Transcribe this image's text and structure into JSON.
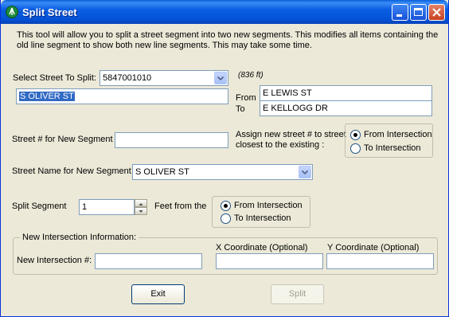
{
  "window": {
    "title": "Split Street",
    "description": "This tool will allow you to split a street segment into two new segments.  This modifies all items containing the old line segment to show both new line segments.  This may take some time."
  },
  "select_street": {
    "label": "Select Street To Split:",
    "value": "5847001010",
    "length": "(836 ft)",
    "street_name": "S OLIVER ST",
    "from_label": "From",
    "from_value": "E LEWIS ST",
    "to_label": "To",
    "to_value": "E KELLOGG DR"
  },
  "new_segment": {
    "street_num_label": "Street # for New Segment",
    "street_num_value": "",
    "assign_label": "Assign new street # to street closest to the existing :",
    "assign_options": [
      "From Intersection",
      "To Intersection"
    ],
    "assign_selected": 0,
    "street_name_label": "Street Name for New Segment",
    "street_name_value": "S OLIVER ST"
  },
  "split": {
    "label": "Split Segment",
    "value": "1",
    "feet_label": "Feet from the",
    "options": [
      "From Intersection",
      "To Intersection"
    ],
    "selected": 0
  },
  "intersection": {
    "group_label": "New Intersection Information:",
    "num_label": "New Intersection #:",
    "num_value": "",
    "x_label": "X Coordinate (Optional)",
    "x_value": "",
    "y_label": "Y Coordinate (Optional)",
    "y_value": ""
  },
  "buttons": {
    "exit": "Exit",
    "split": "Split"
  }
}
